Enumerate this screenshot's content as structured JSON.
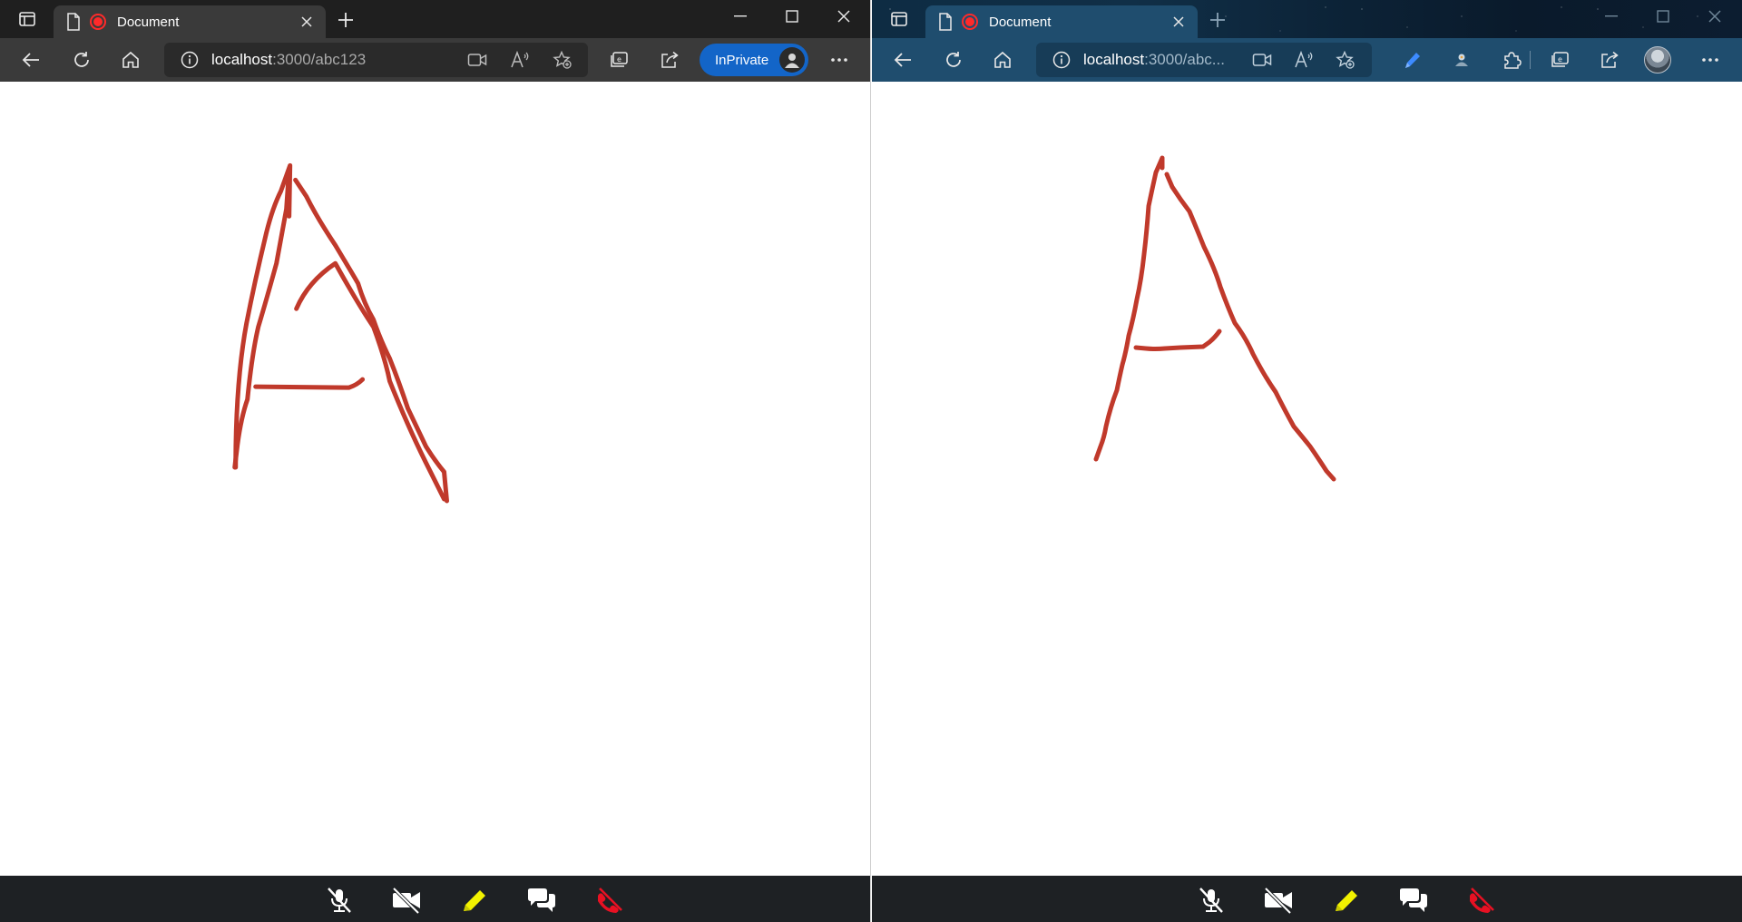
{
  "left_window": {
    "tab": {
      "title": "Document",
      "doc_icon": "page-icon",
      "status_icon": "recording-icon"
    },
    "address": {
      "host": "localhost",
      "rest": ":3000/abc123"
    },
    "inprivate_label": "InPrivate",
    "toolbar_icons": [
      "back-icon",
      "refresh-icon",
      "home-icon",
      "info-icon",
      "video-icon",
      "read-aloud-icon",
      "add-favorite-icon",
      "collections-icon",
      "share-icon",
      "more-icon"
    ],
    "call_buttons": [
      "mic-muted-icon",
      "video-off-icon",
      "pencil-icon",
      "chat-icon",
      "hang-up-icon"
    ]
  },
  "right_window": {
    "tab": {
      "title": "Document",
      "doc_icon": "page-icon",
      "status_icon": "recording-icon"
    },
    "address": {
      "host": "localhost",
      "rest": ":3000/abc..."
    },
    "toolbar_icons": [
      "back-icon",
      "refresh-icon",
      "home-icon",
      "info-icon",
      "video-icon",
      "read-aloud-icon",
      "add-favorite-icon",
      "pen-icon",
      "extension-icon",
      "puzzle-icon",
      "collections-icon",
      "share-icon",
      "profile-avatar",
      "more-icon"
    ],
    "call_buttons": [
      "mic-muted-icon",
      "video-off-icon",
      "pencil-icon",
      "chat-icon",
      "hang-up-icon"
    ]
  },
  "drawing": {
    "stroke_color": "#c0392b",
    "shape": "hand-drawn letter A"
  },
  "colors": {
    "pencil": "#f2f200",
    "hang_up": "#e81123",
    "inprivate": "#1365c8",
    "recording": "#ff2a2a"
  }
}
